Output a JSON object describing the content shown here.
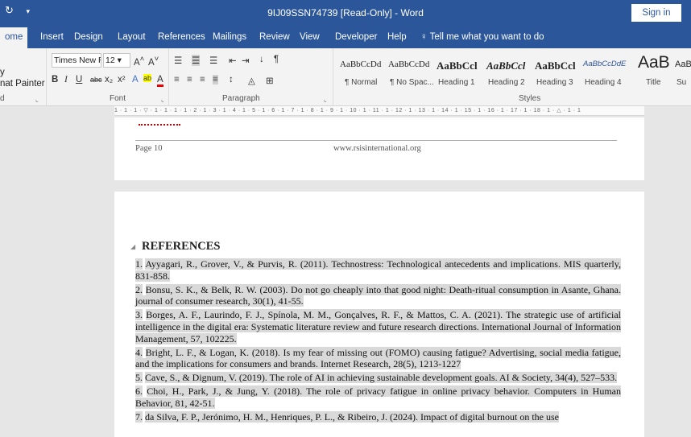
{
  "titlebar": {
    "qat_icons": [
      "undo-redo-icon",
      "customize-qat-icon"
    ],
    "title": "9IJ09SSN74739 [Read-Only]  -  Word",
    "signin": "Sign in"
  },
  "tabs": [
    "ome",
    "Insert",
    "Design",
    "Layout",
    "References",
    "Mailings",
    "Review",
    "View",
    "Developer",
    "Help"
  ],
  "tell_me": "Tell me what you want to do",
  "clipboard": {
    "line1": "y",
    "line2": "nat Painter",
    "label": "d"
  },
  "font": {
    "name": "Times New R",
    "size": "12",
    "label": "Font"
  },
  "paragraph": {
    "label": "Paragraph"
  },
  "styles": {
    "label": "Styles",
    "items": [
      {
        "sample": "AaBbCcDd",
        "name": "¶ Normal"
      },
      {
        "sample": "AaBbCcDd",
        "name": "¶ No Spac..."
      },
      {
        "sample": "AaBbCcl",
        "name": "Heading 1"
      },
      {
        "sample": "AaBbCcl",
        "name": "Heading 2"
      },
      {
        "sample": "AaBbCcl",
        "name": "Heading 3"
      },
      {
        "sample": "AaBbCcDdE",
        "name": "Heading 4"
      },
      {
        "sample": "AaB",
        "name": "Title"
      },
      {
        "sample": "AaB",
        "name": "Su"
      }
    ]
  },
  "ruler": "1 · 1 · 1 · ▽ · 1 · 1 · 1 · 1 · 2 · 1 · 3 · 1 · 4 · 1 · 5 · 1 · 6 · 1 · 7 · 1 · 8 · 1 · 9 · 1 · 10 · 1 · 11 · 1 · 12 · 1 · 13 · 1 · 14 · 1 · 15 · 1 · 16 · 1 · 17 · 1 · 18 · 1 · △ · 1 · 1",
  "page_footer": {
    "page_no": "Page 10",
    "site": "www.rsisinternational.org"
  },
  "references": {
    "heading": "REFERENCES",
    "items": [
      {
        "num": "1.",
        "text": "Ayyagari, R., Grover, V., & Purvis, R. (2011). Technostress: Technological antecedents and implications. MIS quarterly, 831-858."
      },
      {
        "num": "2.",
        "text": "Bonsu, S. K., & Belk, R. W. (2003). Do not go cheaply into that good night: Death-ritual consumption in Asante, Ghana. journal of consumer research, 30(1), 41-55."
      },
      {
        "num": "3.",
        "text": "Borges, A. F., Laurindo, F. J., Spínola, M. M., Gonçalves, R. F., & Mattos, C. A. (2021). The strategic use of artificial intelligence in the digital era: Systematic literature review and future research directions. International Journal of Information Management, 57, 102225."
      },
      {
        "num": "4.",
        "text": "Bright, L. F., & Logan, K. (2018). Is my fear of missing out (FOMO) causing fatigue? Advertising, social media fatigue, and the implications for consumers and brands. Internet Research, 28(5), 1213-1227"
      },
      {
        "num": "5.",
        "text": "Cave, S., & Dignum, V. (2019). The role of AI in achieving sustainable development goals. AI & Society, 34(4), 527–533."
      },
      {
        "num": "6.",
        "text": "Choi, H., Park, J., & Jung, Y. (2018). The role of privacy fatigue in online privacy behavior. Computers in Human Behavior, 81, 42-51."
      },
      {
        "num": "7.",
        "text": "da Silva, F. P., Jerónimo, H. M., Henriques, P. L., & Ribeiro, J. (2024). Impact of digital burnout on the use"
      }
    ]
  }
}
